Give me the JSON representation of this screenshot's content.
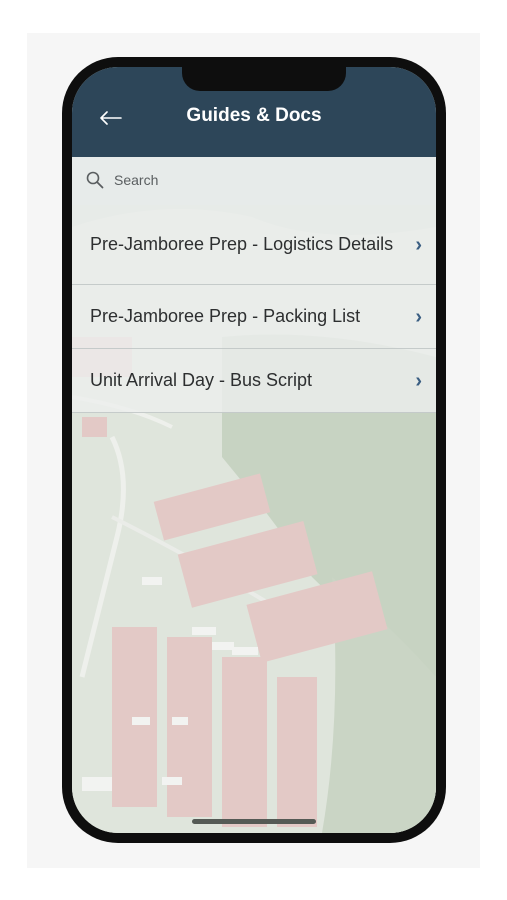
{
  "header": {
    "title": "Guides & Docs",
    "back_icon": "arrow-left-icon"
  },
  "search": {
    "placeholder": "Search",
    "value": "",
    "icon": "search-icon"
  },
  "items": [
    {
      "label": "Pre-Jamboree Prep - Logistics Details",
      "icon": "chevron-right-icon"
    },
    {
      "label": "Pre-Jamboree Prep - Packing List",
      "icon": "chevron-right-icon"
    },
    {
      "label": "Unit Arrival Day - Bus Script",
      "icon": "chevron-right-icon"
    }
  ],
  "colors": {
    "header_bg": "#2d4659",
    "chevron": "#3a5e82",
    "list_bg": "#eceeee"
  }
}
